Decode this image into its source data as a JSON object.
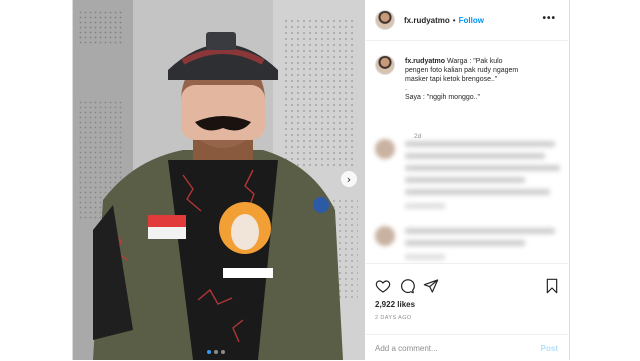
{
  "post": {
    "header": {
      "username": "fx.rudyatmo",
      "separator": "•",
      "follow_label": "Follow",
      "more_icon": "more-options-icon"
    },
    "caption": {
      "username": "fx.rudyatmo",
      "lines": [
        "Warga : \"Pak kulo",
        "pengen foto kalian pak rudy ngagem",
        "masker tapi ketok brengose..\"",
        ".",
        "Saya : \"nggih monggo..\""
      ],
      "time": "2d"
    },
    "likes": "2,922 likes",
    "posted": "2 DAYS AGO",
    "composer": {
      "placeholder": "Add a comment...",
      "post_label": "Post"
    },
    "colors": {
      "accent": "#0095f6",
      "post_disabled": "#b2dffc",
      "text": "#262626",
      "muted": "#8e8e8e",
      "carousel_active_dot": "#3897f0"
    },
    "icons": {
      "like": "heart-icon",
      "comment": "comment-icon",
      "share": "share-icon",
      "save": "bookmark-icon",
      "carousel_next": "chevron-right-icon"
    },
    "carousel": {
      "current": 1,
      "total": 3
    }
  }
}
